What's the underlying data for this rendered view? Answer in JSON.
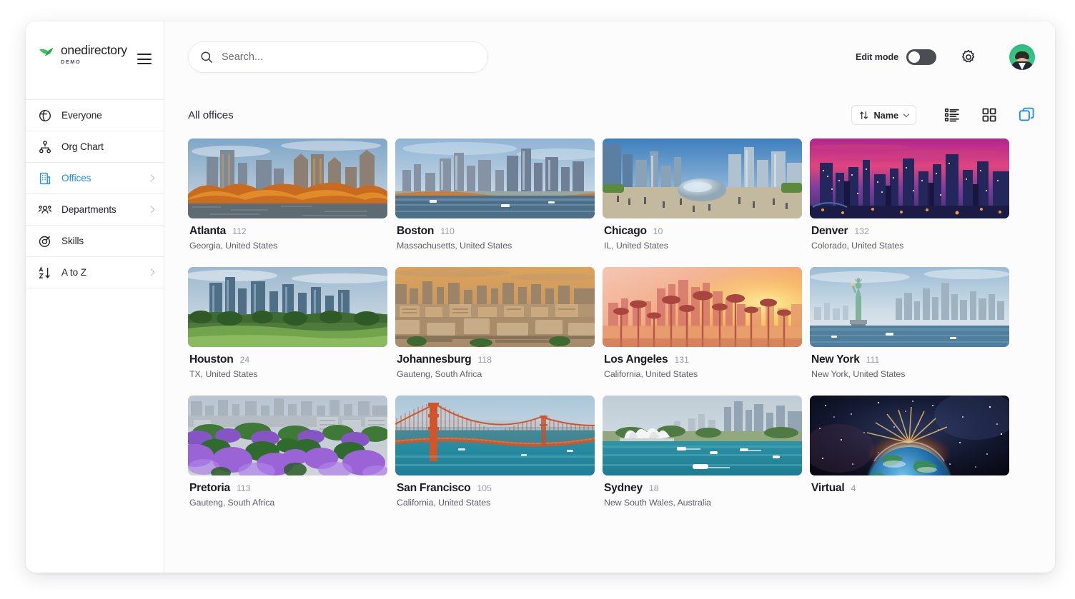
{
  "brand": {
    "name": "onedirectory",
    "sub": "DEMO",
    "logo_icon": "onedirectory-leaf-logo",
    "menu_icon": "hamburger-menu-icon"
  },
  "sidebar": {
    "items": [
      {
        "label": "Everyone",
        "icon": "globe-icon",
        "active": false,
        "chevron": false
      },
      {
        "label": "Org Chart",
        "icon": "org-chart-icon",
        "active": false,
        "chevron": false
      },
      {
        "label": "Offices",
        "icon": "building-icon",
        "active": true,
        "chevron": true
      },
      {
        "label": "Departments",
        "icon": "people-group-icon",
        "active": false,
        "chevron": true
      },
      {
        "label": "Skills",
        "icon": "target-icon",
        "active": false,
        "chevron": false
      },
      {
        "label": "A to Z",
        "icon": "sort-alpha-icon",
        "active": false,
        "chevron": true
      }
    ]
  },
  "topbar": {
    "search": {
      "placeholder": "Search...",
      "value": "",
      "icon": "search-icon"
    },
    "edit_mode_label": "Edit mode",
    "edit_mode_on": false,
    "settings_icon": "gear-icon",
    "avatar_icon": "user-avatar"
  },
  "content": {
    "section_title": "All offices",
    "sort": {
      "label": "Name",
      "icon": "sort-arrows-icon",
      "caret_icon": "chevron-down-icon"
    },
    "views": [
      {
        "name": "list-view-button",
        "icon": "list-view-icon",
        "active": false
      },
      {
        "name": "grid-view-button",
        "icon": "grid-view-icon",
        "active": false
      },
      {
        "name": "card-view-button",
        "icon": "card-stack-view-icon",
        "active": true
      }
    ],
    "active_view_color": "#1d8df2"
  },
  "offices": [
    {
      "name": "Atlanta",
      "count": "112",
      "location": "Georgia, United States",
      "image": "atlanta-skyline-autumn"
    },
    {
      "name": "Boston",
      "count": "110",
      "location": "Massachusetts, United States",
      "image": "boston-skyline-harbor"
    },
    {
      "name": "Chicago",
      "count": "10",
      "location": "IL, United States",
      "image": "chicago-millennium-park"
    },
    {
      "name": "Denver",
      "count": "132",
      "location": "Colorado, United States",
      "image": "denver-skyline-sunset"
    },
    {
      "name": "Houston",
      "count": "24",
      "location": "TX, United States",
      "image": "houston-skyline-park"
    },
    {
      "name": "Johannesburg",
      "count": "118",
      "location": "Gauteng, South Africa",
      "image": "johannesburg-cityscape"
    },
    {
      "name": "Los Angeles",
      "count": "131",
      "location": "California, United States",
      "image": "los-angeles-palms-sunset"
    },
    {
      "name": "New York",
      "count": "111",
      "location": "New York, United States",
      "image": "new-york-statue-liberty"
    },
    {
      "name": "Pretoria",
      "count": "113",
      "location": "Gauteng, South Africa",
      "image": "pretoria-jacaranda"
    },
    {
      "name": "San Francisco",
      "count": "105",
      "location": "California, United States",
      "image": "san-francisco-golden-gate"
    },
    {
      "name": "Sydney",
      "count": "18",
      "location": "New South Wales, Australia",
      "image": "sydney-opera-house-harbor"
    },
    {
      "name": "Virtual",
      "count": "4",
      "location": "",
      "image": "earth-from-space"
    }
  ]
}
